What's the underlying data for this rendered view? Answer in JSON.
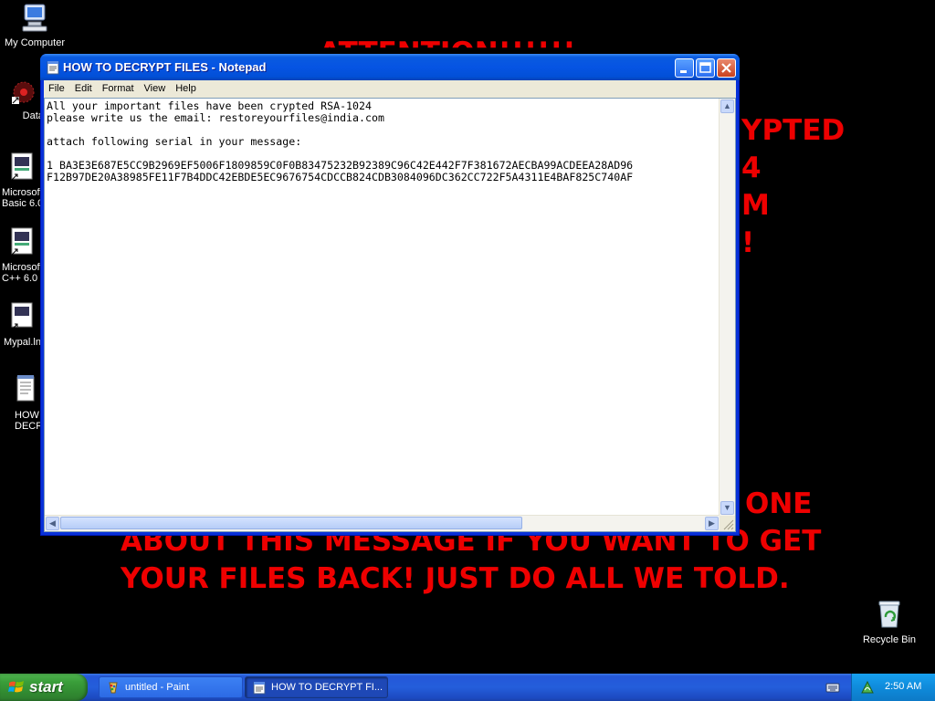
{
  "wallpaper": {
    "lines": [
      {
        "text": "ATTENTION!!!!!!"
      },
      {
        "text": "YPTED"
      },
      {
        "text": "4"
      },
      {
        "text": "M"
      },
      {
        "text": "!"
      },
      {
        "text": "ONE"
      },
      {
        "text": "ABOUT THIS MESSAGE IF YOU WANT TO GET"
      },
      {
        "text": "YOUR FILES BACK! JUST DO ALL WE TOLD."
      }
    ],
    "color": "#e00000"
  },
  "desktop_icons": [
    {
      "label": "My Computer",
      "icon": "my-computer-icon"
    },
    {
      "label": "DataWa",
      "icon": "datawatch-icon"
    },
    {
      "label": "Microsoft\nBasic 6.0",
      "icon": "program-icon"
    },
    {
      "label": "Microsoft\nC++ 6.0",
      "icon": "program-icon"
    },
    {
      "label": "Mypal.ln",
      "icon": "shortcut-icon"
    },
    {
      "label": "HOW\nDECR",
      "icon": "text-file-icon"
    },
    {
      "label": "Recycle Bin",
      "icon": "recycle-bin-icon"
    }
  ],
  "notepad": {
    "title": "HOW TO DECRYPT FILES - Notepad",
    "menu": [
      "File",
      "Edit",
      "Format",
      "View",
      "Help"
    ],
    "text_lines": [
      "All your important files have been crypted RSA-1024",
      "please write us the email: restoreyourfiles@india.com",
      "",
      "attach following serial in your message:",
      "",
      "1 BA3E3E687E5CC9B2969EF5006F1809859C0F0B83475232B92389C96C42E442F7F381672AECBA99ACDEEA28AD96",
      "F12B97DE20A38985FE11F7B4DDC42EBDE5EC9676754CDCCB824CDB3084096DC362CC722F5A4311E4BAF825C740AF"
    ]
  },
  "taskbar": {
    "start_label": "start",
    "tasks": [
      {
        "label": "untitled - Paint",
        "active": false,
        "icon": "paint-icon"
      },
      {
        "label": "HOW TO DECRYPT FI...",
        "active": true,
        "icon": "notepad-icon"
      }
    ],
    "clock": "2:50 AM"
  },
  "colors": {
    "titlebar": "#0654e3",
    "taskbar": "#245edb",
    "start_button": "#3a9e3a",
    "tray": "#0f8bdb"
  }
}
